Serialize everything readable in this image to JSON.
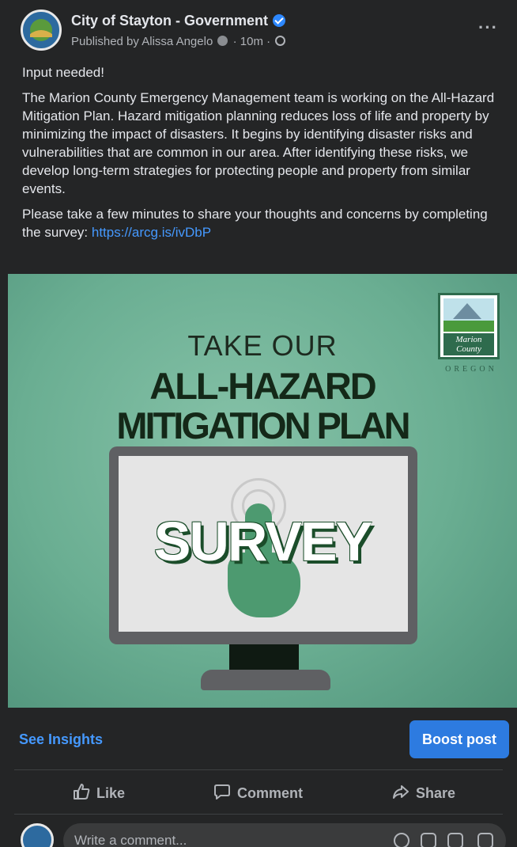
{
  "header": {
    "page_name": "City of Stayton - Government",
    "published_by": "Published by Alissa Angelo",
    "time": "· 10m ·",
    "more": "···"
  },
  "post": {
    "intro": "Input needed!",
    "body": "The Marion County Emergency Management team is working on the All-Hazard Mitigation Plan. Hazard mitigation planning reduces loss of life and property by minimizing the impact of disasters. It begins by identifying disaster risks and vulnerabilities that are common in our area. After identifying these risks, we develop long-term strategies for protecting people and property from similar events.",
    "cta_text": "Please take a few minutes to share your thoughts and concerns by completing the survey: ",
    "link": "https://arcg.is/ivDbP"
  },
  "image": {
    "line1": "TAKE OUR",
    "line2": "ALL-HAZARD",
    "line3": "MITIGATION PLAN",
    "survey": "SURVEY",
    "logo_text": "Marion County",
    "logo_state": "OREGON"
  },
  "insights": {
    "see_insights": "See Insights",
    "boost": "Boost post"
  },
  "actions": {
    "like": "Like",
    "comment": "Comment",
    "share": "Share"
  },
  "comment": {
    "placeholder": "Write a comment..."
  },
  "colors": {
    "background": "#242526",
    "link": "#4599ff",
    "boost": "#2d7be0",
    "image_green": "#6fb397"
  }
}
